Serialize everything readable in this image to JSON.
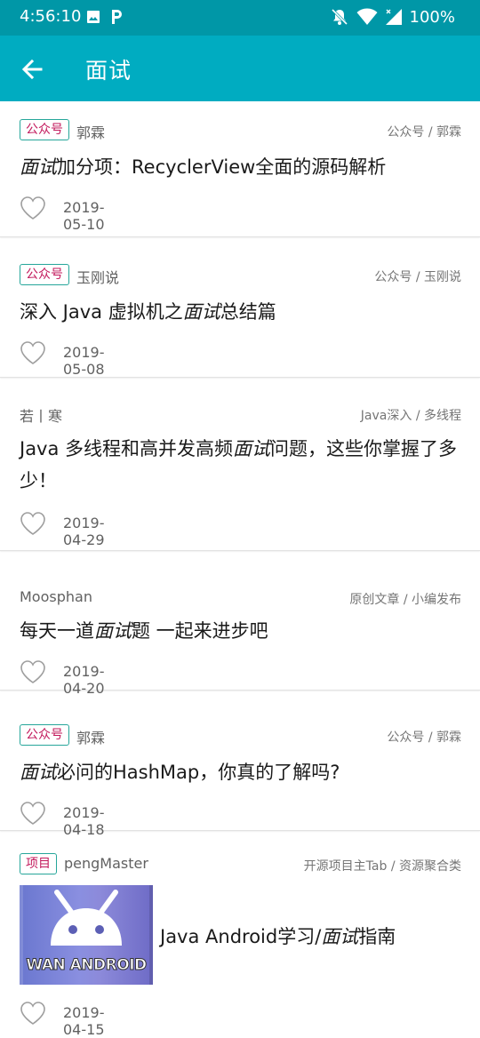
{
  "status_bar": {
    "time": "4:56:10",
    "battery": "100%"
  },
  "app_bar": {
    "title": "面试"
  },
  "articles": [
    {
      "tag": "公众号",
      "author": "郭霖",
      "category": "公众号 / 郭霖",
      "title_pre": "",
      "title_em": "面试",
      "title_post": "加分项：RecyclerView全面的源码解析",
      "date": "2019-05-10"
    },
    {
      "tag": "公众号",
      "author": "玉刚说",
      "category": "公众号 / 玉刚说",
      "title_pre": "深入 Java 虚拟机之",
      "title_em": "面试",
      "title_post": "总结篇",
      "date": "2019-05-08"
    },
    {
      "tag": "",
      "author": "若丨寒",
      "category": "Java深入 / 多线程",
      "title_pre": "Java 多线程和高并发高频",
      "title_em": "面试",
      "title_post": "问题，这些你掌握了多少！",
      "date": "2019-04-29"
    },
    {
      "tag": "",
      "author": "Moosphan",
      "category": "原创文章 / 小编发布",
      "title_pre": "每天一道",
      "title_em": "面试",
      "title_post": "题 一起来进步吧",
      "date": "2019-04-20"
    },
    {
      "tag": "公众号",
      "author": "郭霖",
      "category": "公众号 / 郭霖",
      "title_pre": "",
      "title_em": "面试",
      "title_post": "必问的HashMap，你真的了解吗?",
      "date": "2019-04-18"
    },
    {
      "tag": "项目",
      "author": "pengMaster",
      "category": "开源项目主Tab / 资源聚合类",
      "title_pre": "Java Android学习/",
      "title_em": "面试",
      "title_post": "指南",
      "date": "2019-04-15",
      "thumbnail_text": "WAN ANDROID"
    }
  ],
  "colors": {
    "status_bar": "#0097a7",
    "app_bar": "#00acc1",
    "tag_border": "#26a69a",
    "tag_text": "#c2185b"
  }
}
